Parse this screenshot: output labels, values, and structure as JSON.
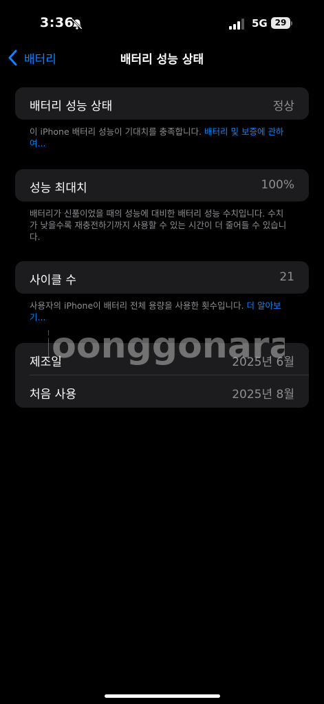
{
  "status_bar": {
    "time": "3:36",
    "network": "5G",
    "battery_level": "29",
    "icons": [
      "bell-slash-icon",
      "cellular-signal-icon",
      "battery-icon"
    ]
  },
  "nav": {
    "back_label": "배터리",
    "title": "배터리 성능 상태",
    "icons": [
      "chevron-left-icon"
    ]
  },
  "health": {
    "label": "배터리 성능 상태",
    "value": "정상",
    "footer_text": "이 iPhone 배터리 성능이 기대치를 충족합니다. ",
    "footer_link": "배터리 및 보증에 관하여..."
  },
  "max_capacity": {
    "label": "성능 최대치",
    "value": "100%",
    "footer_text": "배터리가 신품이었을 때의 성능에 대비한 배터리 성능 수치입니다. 수치가 낮을수록 재충전하기까지 사용할 수 있는 시간이 더 줄어들 수 있습니다."
  },
  "cycle_count": {
    "label": "사이클 수",
    "value": "21",
    "footer_text": "사용자의 iPhone이 배터리 전체 용량을 사용한 횟수입니다. ",
    "footer_link": "더 알아보기..."
  },
  "dates": {
    "manufacture_label": "제조일",
    "manufacture_value": "2025년 6월",
    "first_use_label": "처음 사용",
    "first_use_value": "2025년 8월"
  },
  "watermark": {
    "text": "joonggonara"
  },
  "colors": {
    "accent": "#0a84ff",
    "background": "#000000",
    "cell": "#1c1c1e",
    "secondary_text": "#8e8e93"
  }
}
